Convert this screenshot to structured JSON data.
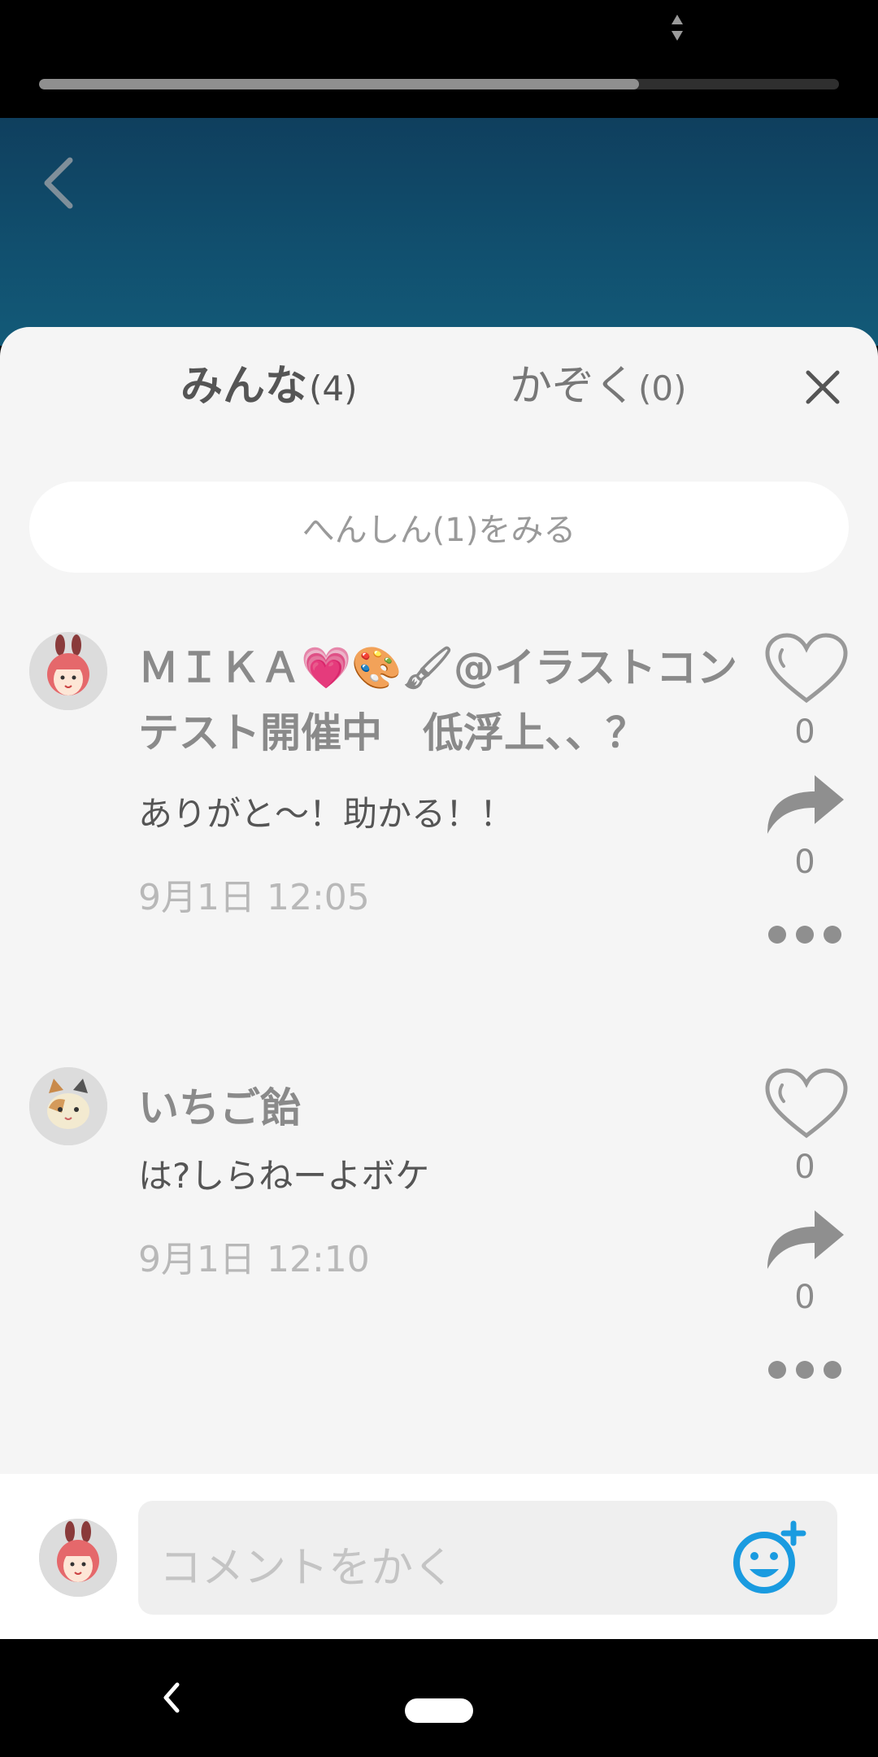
{
  "status": {
    "progress": 0.75
  },
  "tabs": [
    {
      "label": "みんな",
      "count": "(4)"
    },
    {
      "label": "かぞく",
      "count": "(0)"
    }
  ],
  "replies_button": "へんしん(1)をみる",
  "comments": [
    {
      "author": "ＭＩＫＡ💗🎨🖌@イラストコンテスト開催中　低浮上、、？",
      "text": "ありがと〜！助かる！！",
      "time": "9月1日 12:05",
      "likes": "0",
      "shares": "0"
    },
    {
      "author": "いちご飴",
      "text": "は?しらねーよボケ",
      "time": "9月1日 12:10",
      "likes": "0",
      "shares": "0"
    }
  ],
  "composer": {
    "placeholder": "コメントをかく"
  },
  "colors": {
    "accent": "#1a9be0",
    "header": "#11506f"
  },
  "icons": [
    "back-arrow-icon",
    "close-icon",
    "heart-icon",
    "share-icon",
    "more-icon",
    "emoji-add-icon"
  ]
}
